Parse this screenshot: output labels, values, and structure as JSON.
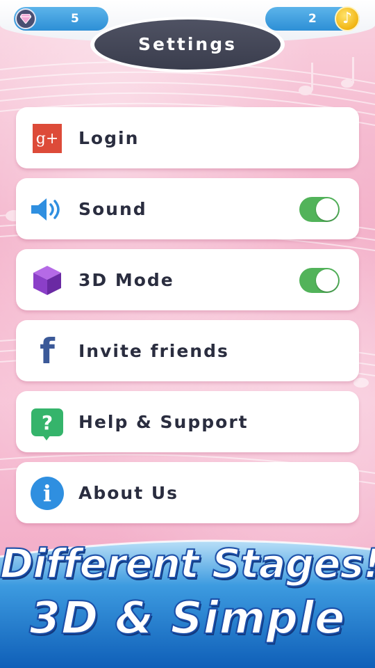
{
  "header": {
    "title": "Settings",
    "gems": "5",
    "coins": "2",
    "gem_icon": "diamond-icon",
    "coin_icon": "music-note-icon"
  },
  "settings": {
    "items": [
      {
        "label": "Login",
        "icon": "google-plus-icon"
      },
      {
        "label": "Sound",
        "icon": "speaker-icon",
        "toggle": true
      },
      {
        "label": "3D Mode",
        "icon": "cube-icon",
        "toggle": true
      },
      {
        "label": "Invite friends",
        "icon": "facebook-icon"
      },
      {
        "label": "Help & Support",
        "icon": "help-question-icon"
      },
      {
        "label": "About Us",
        "icon": "info-icon"
      }
    ],
    "google_plus_glyph": "g+",
    "facebook_glyph": "f",
    "help_glyph": "?",
    "info_glyph": "i"
  },
  "promo": {
    "line1": "Different Stages!",
    "line2": "3D & Simple"
  },
  "colors": {
    "accent_blue": "#2d8fd6",
    "toggle_on": "#52b35a",
    "title_bg": "#3a3d4d",
    "google_red": "#dd4b39",
    "facebook_blue": "#3b5998",
    "help_green": "#35b46b",
    "info_blue": "#2f8fe0",
    "cube_purple": "#8b3fc8"
  }
}
